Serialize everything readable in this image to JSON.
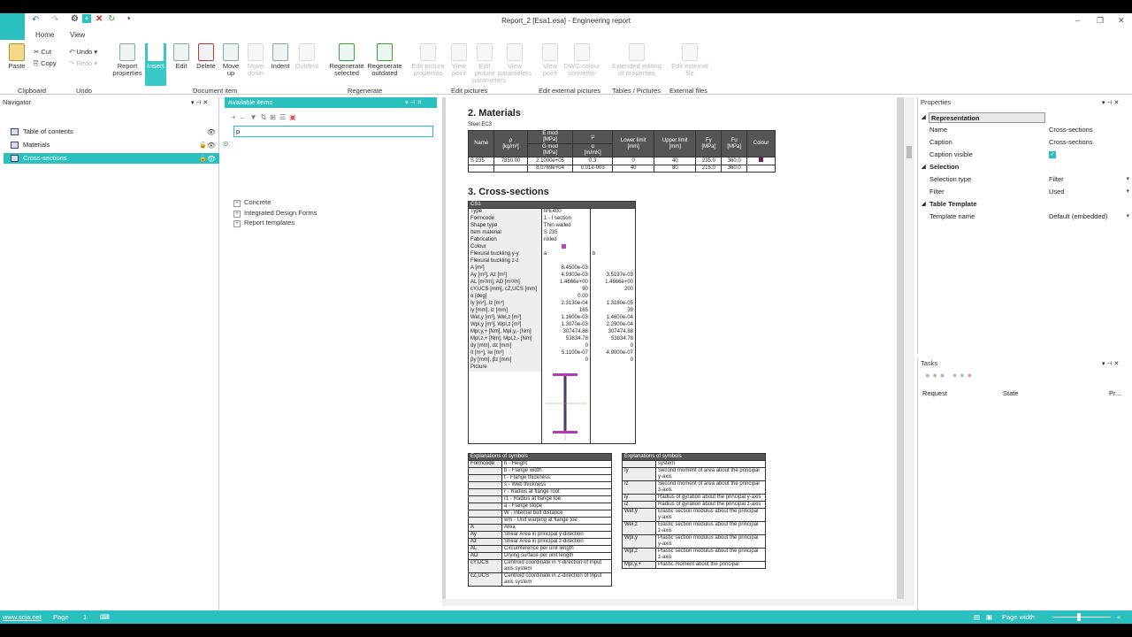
{
  "window": {
    "title": "Report_2 [Esa1.esa] - Engineering report"
  },
  "ribbon_tabs": [
    "Home",
    "View"
  ],
  "clipboard": {
    "paste": "Paste",
    "cut": "Cut",
    "copy": "Copy",
    "group": "Clipboard"
  },
  "undo": {
    "undo": "Undo",
    "redo": "Redo",
    "group": "Undo"
  },
  "doc_item": {
    "report_properties": "Report properties",
    "insert": "Insert",
    "edit": "Edit",
    "delete": "Delete",
    "move_up": "Move up",
    "move_down": "Move down",
    "indent": "Indent",
    "outdent": "Outdent",
    "group": "Document item"
  },
  "regenerate": {
    "selected": "Regenerate selected",
    "outdated": "Regenerate outdated",
    "group": "Regenerate"
  },
  "edit_pictures": {
    "edit_picture_properties": "Edit picture properties",
    "view_point": "View point",
    "edit_picture_params": "Edit picture parameters",
    "view_parameters": "View parameters",
    "group": "Edit pictures"
  },
  "edit_external": {
    "view_point": "View point",
    "dwg_colour": "DWG colour converter",
    "group": "Edit external pictures"
  },
  "tables": {
    "extended": "Extended editing of properties",
    "group": "Tables / Pictures"
  },
  "external_files": {
    "edit": "Edit external file",
    "group": "External files"
  },
  "navigator": {
    "title": "Navigator",
    "items": [
      "Table of contents",
      "Materials",
      "Cross-sections"
    ]
  },
  "available": {
    "title": "Available items",
    "search_value": "p",
    "tree": [
      "Concrete",
      "Integrated Design Forms",
      "Report templates"
    ]
  },
  "doc": {
    "materials_title": "2. Materials",
    "steel_label": "Steel  EC3",
    "mat_headers": [
      "Name",
      "ρ\n[kg/m³]",
      "E mod\n[MPa]",
      "μ",
      "Lower limit\n[mm]",
      "Upper limit\n[mm]",
      "Fy\n[MPa]",
      "Fu\n[MPa]",
      "Colour"
    ],
    "mat_sub": [
      "G mod\n[MPa]",
      "α\n[m/mK]"
    ],
    "mat_rows": [
      [
        "S 235",
        "7850.00",
        "2.1000e+05",
        "0.3",
        "0",
        "40",
        "235.0",
        "360.0"
      ],
      [
        "",
        "",
        "8.0769e+04",
        "0.01e-003",
        "40",
        "80",
        "215.0",
        "360.0"
      ]
    ],
    "cs_title": "3. Cross-sections",
    "cs_name": "CS1",
    "cs_rows": [
      [
        "Type",
        "IPE400",
        ""
      ],
      [
        "Formcode",
        "1 - I section",
        ""
      ],
      [
        "Shape type",
        "Thin-walled",
        ""
      ],
      [
        "Item material",
        "S 235",
        ""
      ],
      [
        "Fabrication",
        "rolled",
        ""
      ],
      [
        "Colour",
        "",
        ""
      ],
      [
        "Flexural buckling y-y",
        "a",
        "b"
      ],
      [
        "Flexural buckling z-z",
        "",
        ""
      ],
      [
        "A [m²]",
        "8.4500e-03",
        ""
      ],
      [
        "Ay [m²], Az [m²]",
        "4.9303e-03",
        "3.5197e-03"
      ],
      [
        "AL [m²/m], AD [m²/m]",
        "1.4666e+00",
        "1.4666e+00"
      ],
      [
        "cY,UCS [mm], cZ,UCS [mm]",
        "90",
        "200"
      ],
      [
        "α [deg]",
        "0.00",
        ""
      ],
      [
        "Iy [m⁴], Iz [m⁴]",
        "2.3130e-04",
        "1.3180e-05"
      ],
      [
        "iy [mm], iz [mm]",
        "165",
        "39"
      ],
      [
        "Wel,y [m³], Wel,z [m³]",
        "1.1600e-03",
        "1.4600e-04"
      ],
      [
        "Wpl,y [m³], Wpl,z [m³]",
        "1.3070e-03",
        "2.2900e-04"
      ],
      [
        "Mpl,y,+ [Nm], Mpl,y,- [Nm]",
        "307474.88",
        "307474.88"
      ],
      [
        "Mpl,z,+ [Nm], Mpl,z,- [Nm]",
        "53834.78",
        "53834.78"
      ],
      [
        "dy [mm], dz [mm]",
        "0",
        "0"
      ],
      [
        "It [m⁴], Iw [m⁶]",
        "5.1100e-07",
        "4.9000e-07"
      ],
      [
        "βy [mm], βz [mm]",
        "0",
        "0"
      ],
      [
        "Picture",
        "",
        ""
      ]
    ],
    "expl_title": "Explanations of symbols",
    "expl_left": [
      [
        "Formcode",
        "h - Height"
      ],
      [
        "",
        "b - Flange width"
      ],
      [
        "",
        "t - Flange thickness"
      ],
      [
        "",
        "s - Web thickness"
      ],
      [
        "",
        "r - Radius at flange root"
      ],
      [
        "",
        "r1 - Radius at flange toe"
      ],
      [
        "",
        "a - Flange slope"
      ],
      [
        "",
        "W - Internal bolt distance"
      ],
      [
        "",
        "wm - Unit warping at flange toe"
      ],
      [
        "A",
        "Area"
      ],
      [
        "Ay",
        "Shear Area in principal y-direction"
      ],
      [
        "Az",
        "Shear Area in principal z-direction"
      ],
      [
        "AL",
        "Circumference per unit length"
      ],
      [
        "AD",
        "Drying surface per unit length"
      ],
      [
        "cY,UCS",
        "Centroid coordinate in Y-direction of Input axis system"
      ],
      [
        "cZ,UCS",
        "Centroid coordinate in Z-direction of Input axis system"
      ]
    ],
    "expl_right": [
      [
        "",
        "system"
      ],
      [
        "Iy",
        "Second moment of area about the principal y-axis"
      ],
      [
        "Iz",
        "Second moment of area about the principal z-axis"
      ],
      [
        "iy",
        "Radius of gyration about the principal y-axis"
      ],
      [
        "iz",
        "Radius of gyration about the principal z-axis"
      ],
      [
        "Wel,y",
        "Elastic section modulus about the principal y-axis"
      ],
      [
        "Wel,z",
        "Elastic section modulus about the principal z-axis"
      ],
      [
        "Wpl,y",
        "Plastic section modulus about the principal y-axis"
      ],
      [
        "Wpl,z",
        "Plastic section modulus about the principal z-axis"
      ],
      [
        "Mpl,y,+",
        "Plastic moment about the principal"
      ]
    ]
  },
  "properties": {
    "title": "Properties",
    "rows": [
      {
        "k": "Representation",
        "v": "",
        "sec": true
      },
      {
        "k": "Name",
        "v": "Cross-sections"
      },
      {
        "k": "Caption",
        "v": "Cross-sections"
      },
      {
        "k": "Caption visible",
        "v": "",
        "check": true
      },
      {
        "k": "Selection",
        "v": "",
        "sec": true
      },
      {
        "k": "Selection type",
        "v": "Filter",
        "dd": true
      },
      {
        "k": "Filter",
        "v": "Used",
        "dd": true
      },
      {
        "k": "Table Template",
        "v": "",
        "sec": true
      },
      {
        "k": "Template name",
        "v": "Default (embedded)",
        "dd": true
      }
    ]
  },
  "tasks": {
    "title": "Tasks",
    "cols": [
      "Request",
      "State",
      "Pr..."
    ]
  },
  "status": {
    "url": "www.scia.net",
    "page_label": "Page",
    "page_num": "1",
    "page_width": "Page width"
  },
  "colors": {
    "accent": "#2bc0c0"
  }
}
